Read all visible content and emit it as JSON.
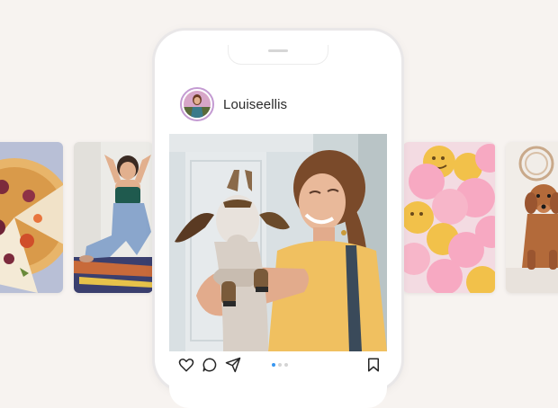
{
  "post": {
    "username": "Louiseellis",
    "carousel_index": 1,
    "carousel_count": 3
  },
  "actions": {
    "like": "heart-icon",
    "comment": "comment-icon",
    "share": "share-icon",
    "save": "bookmark-icon"
  },
  "colors": {
    "background": "#f7f3f0",
    "avatar_ring": "#c49bd2",
    "active_dot": "#3897f0",
    "inactive_dot": "#d4d4d4"
  }
}
